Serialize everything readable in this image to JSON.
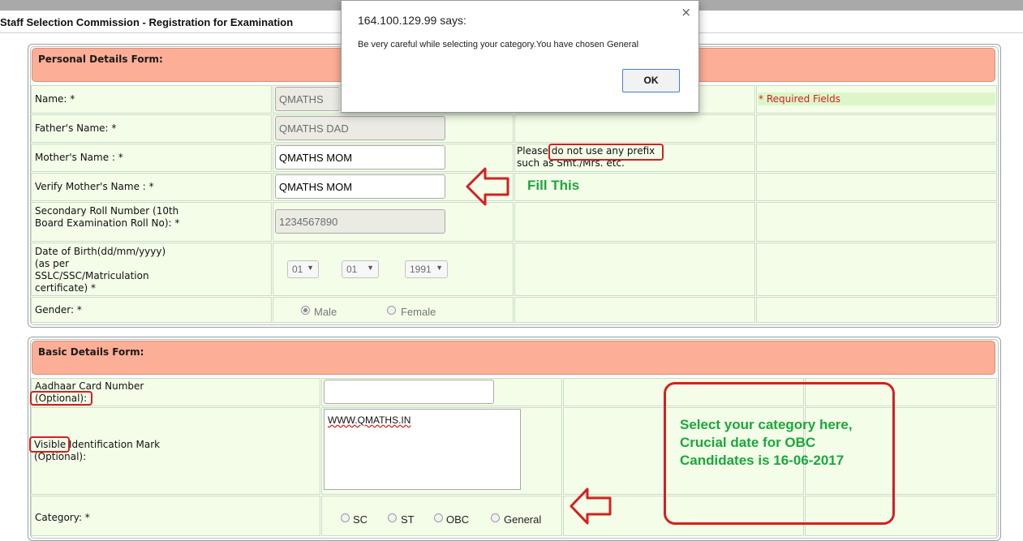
{
  "page": {
    "title": "Staff Selection Commission - Registration for Examination"
  },
  "personal": {
    "header": "Personal Details Form:",
    "required_note": "* Required Fields",
    "name_label": "Name: *",
    "name_value": "QMATHS",
    "father_label": "Father's Name: *",
    "father_value": "QMATHS DAD",
    "mother_label": "Mother's Name : *",
    "mother_value": "QMATHS MOM",
    "mother_note_1": "Please do not use any prefix",
    "mother_note_2": "such as Smt./Mrs. etc.",
    "verify_mother_label": "Verify Mother's Name : *",
    "verify_mother_value": "QMATHS MOM",
    "roll_label": "Secondary Roll Number (10th Board Examination Roll No): *",
    "roll_value": "1234567890",
    "dob_label": "Date of Birth(dd/mm/yyyy) (as per SSLC/SSC/Matriculation certificate) *",
    "dob_day": "01",
    "dob_month": "01",
    "dob_year": "1991",
    "gender_label": "Gender: *",
    "gender_male": "Male",
    "gender_female": "Female"
  },
  "basic": {
    "header": "Basic Details Form:",
    "aadhaar_label": "Aadhaar Card Number (Optional):",
    "aadhaar_value": "",
    "mark_label": "Visible Identification Mark (Optional):",
    "mark_value": "WWW.QMATHS.IN",
    "category_label": "Category: *",
    "category_options": [
      "SC",
      "ST",
      "OBC",
      "General"
    ]
  },
  "annotations": {
    "fill_this": "Fill This",
    "category_note": "Select your category here, Crucial date for OBC Candidates is 16-06-2017",
    "color_red": "#d42020",
    "color_green": "#1aa83a"
  },
  "dialog": {
    "title": "164.100.129.99 says:",
    "message": "Be very careful while selecting your category.You have chosen General",
    "ok_label": "OK",
    "close_glyph": "×"
  }
}
